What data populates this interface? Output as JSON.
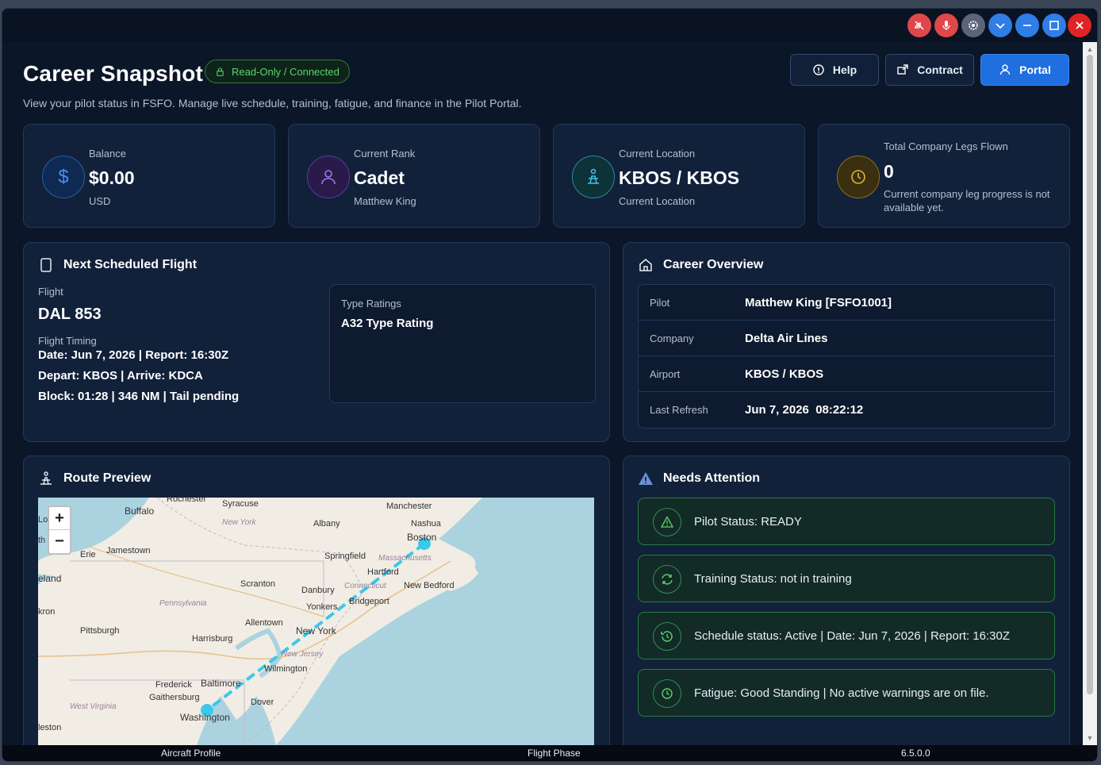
{
  "header": {
    "title": "Career Snapshot",
    "badge": "Read-Only / Connected",
    "subtitle": "View your pilot status in FSFO. Manage live schedule, training, fatigue, and finance in the Pilot Portal.",
    "buttons": {
      "help": "Help",
      "contract": "Contract",
      "portal": "Portal"
    }
  },
  "stats": {
    "balance": {
      "label": "Balance",
      "value": "$0.00",
      "sub": "USD"
    },
    "rank": {
      "label": "Current Rank",
      "value": "Cadet",
      "sub": "Matthew King"
    },
    "location": {
      "label": "Current Location",
      "value": "KBOS / KBOS",
      "sub": "Current Location"
    },
    "legs": {
      "label": "Total Company Legs Flown",
      "value": "0",
      "sub": "Current company leg progress is not available yet."
    }
  },
  "next_flight": {
    "title": "Next Scheduled Flight",
    "flight_label": "Flight",
    "flight": "DAL 853",
    "timing_label": "Flight Timing",
    "line1": "Date: Jun 7, 2026 | Report: 16:30Z",
    "line2": "Depart: KBOS | Arrive: KDCA",
    "line3": "Block: 01:28 | 346 NM | Tail pending",
    "type_label": "Type Ratings",
    "type_value": "A32 Type Rating"
  },
  "overview": {
    "title": "Career Overview",
    "rows": [
      {
        "key": "Pilot",
        "value": "Matthew King [FSFO1001]"
      },
      {
        "key": "Company",
        "value": "Delta Air Lines"
      },
      {
        "key": "Airport",
        "value": "KBOS / KBOS"
      },
      {
        "key": "Last Refresh",
        "value": "Jun 7, 2026  08:22:12"
      }
    ]
  },
  "route": {
    "title": "Route Preview",
    "zoom_in": "+",
    "zoom_out": "−",
    "labels": {
      "rochester": "Rochester",
      "syracuse": "Syracuse",
      "manchester": "Manchester",
      "buffalo": "Buffalo",
      "newyork_state": "New York",
      "albany": "Albany",
      "nashua": "Nashua",
      "boston": "Boston",
      "lo": "Lo",
      "th": "th",
      "erie": "Erie",
      "jamestown": "Jamestown",
      "springfield": "Springfield",
      "massachusetts": "Massachusetts",
      "hartford": "Hartford",
      "cleveland": "eland",
      "scranton": "Scranton",
      "connecticut": "Connecticut",
      "newbedford": "New Bedford",
      "danbury": "Danbury",
      "pennsylvania": "Pennsylvania",
      "bridgeport": "Bridgeport",
      "yonkers": "Yonkers",
      "akron": "kron",
      "allentown": "Allentown",
      "pittsburgh": "Pittsburgh",
      "newyork": "New York",
      "harrisburg": "Harrisburg",
      "newjersey": "New Jersey",
      "wilmington": "Wilmington",
      "frederick": "Frederick",
      "baltimore": "Baltimore",
      "gaithersburg": "Gaithersburg",
      "dover": "Dover",
      "westvirginia": "West Virginia",
      "washington": "Washington",
      "charleston": "leston"
    }
  },
  "attention": {
    "title": "Needs Attention",
    "items": [
      {
        "text": "Pilot Status: READY",
        "icon": "warning-icon"
      },
      {
        "text": "Training Status: not in training",
        "icon": "refresh-icon"
      },
      {
        "text": "Schedule status: Active | Date: Jun 7, 2026 | Report: 16:30Z",
        "icon": "history-icon"
      },
      {
        "text": "Fatigue: Good Standing | No active warnings are on file.",
        "icon": "clock-icon"
      }
    ]
  },
  "statusbar": {
    "aircraft": "Aircraft Profile",
    "phase": "Flight Phase",
    "version": "6.5.0.0"
  },
  "colors": {
    "accent": "#1f6fe0",
    "success": "#5bd36f",
    "route": "#3cc8ea"
  }
}
